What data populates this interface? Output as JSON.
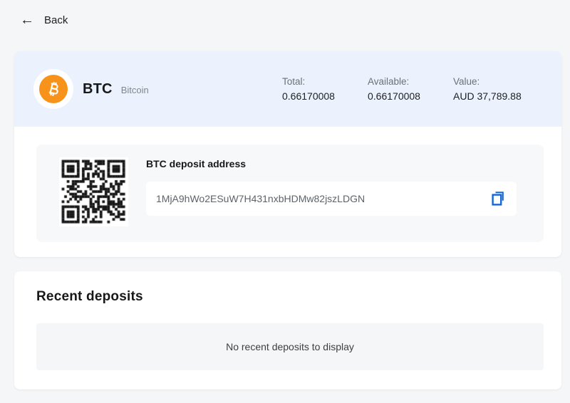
{
  "nav": {
    "back_label": "Back",
    "back_icon": "←"
  },
  "asset": {
    "symbol": "BTC",
    "name": "Bitcoin",
    "stats": [
      {
        "label": "Total:",
        "value": "0.66170008"
      },
      {
        "label": "Available:",
        "value": "0.66170008"
      },
      {
        "label": "Value:",
        "value": "AUD 37,789.88"
      }
    ]
  },
  "deposit": {
    "title": "BTC deposit address",
    "address": "1MjA9hWo2ESuW7H431nxbHDMw82jszLDGN",
    "copy_icon": "copy-icon",
    "qr_icon": "qr-code"
  },
  "recent": {
    "title": "Recent deposits",
    "empty_message": "No recent deposits to display"
  },
  "colors": {
    "accent_blue": "#1565d8",
    "bitcoin_orange": "#f7931a",
    "header_bg": "#ebf2fd",
    "page_bg": "#f5f6f8"
  }
}
